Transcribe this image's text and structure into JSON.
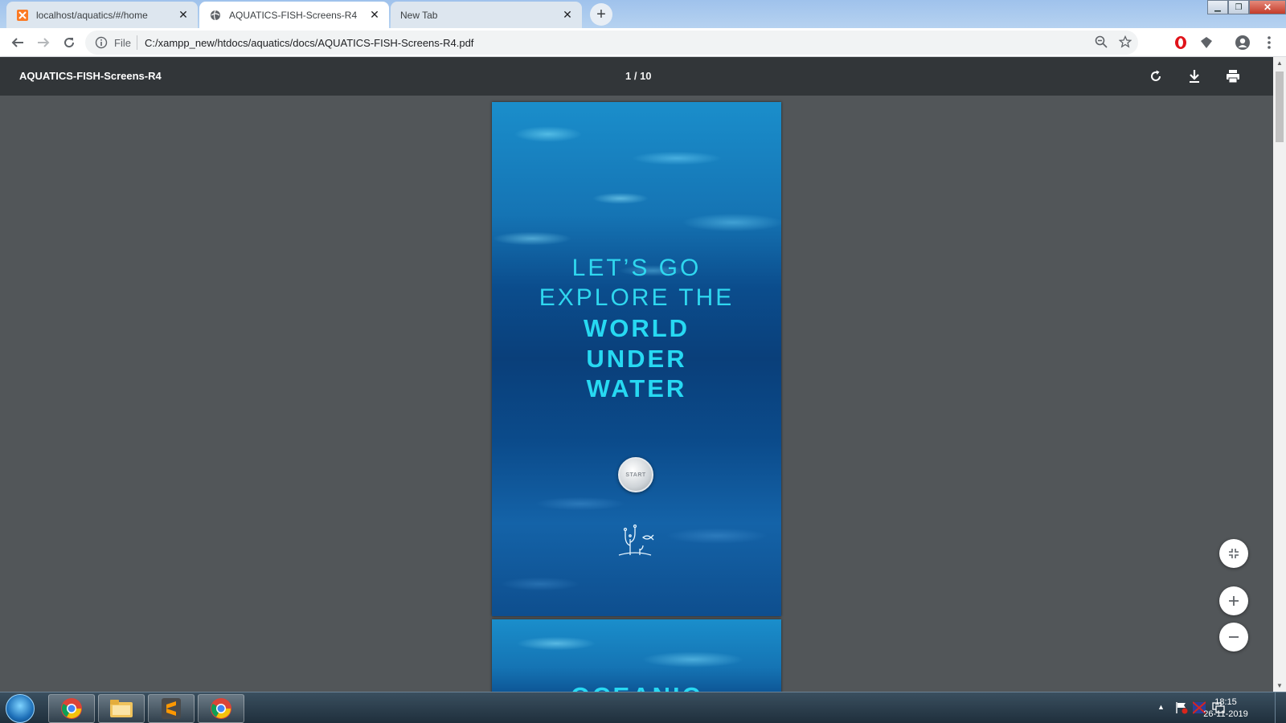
{
  "browser": {
    "tabs": [
      {
        "title": "localhost/aquatics/#/home",
        "active": false,
        "icon": "xampp-icon"
      },
      {
        "title": "AQUATICS-FISH-Screens-R4",
        "active": true,
        "icon": "globe-icon"
      },
      {
        "title": "New Tab",
        "active": false,
        "icon": ""
      }
    ],
    "omnibox": {
      "scheme_label": "File",
      "url": "C:/xampp_new/htdocs/aquatics/docs/AQUATICS-FISH-Screens-R4.pdf"
    }
  },
  "pdf": {
    "title": "AQUATICS-FISH-Screens-R4",
    "page_indicator": "1 / 10",
    "page1": {
      "line1": "LET’S GO",
      "line2": "EXPLORE THE",
      "line3": "WORLD",
      "line4": "UNDER",
      "line5": "WATER",
      "start_label": "START"
    },
    "page2": {
      "partial_heading": "OCEANIC"
    }
  },
  "taskbar": {
    "time": "18:15",
    "date": "26-11-2019"
  },
  "colors": {
    "viewer_bg": "#525659",
    "pdf_toolbar": "#323639",
    "headline_cyan": "#27d9f2"
  }
}
